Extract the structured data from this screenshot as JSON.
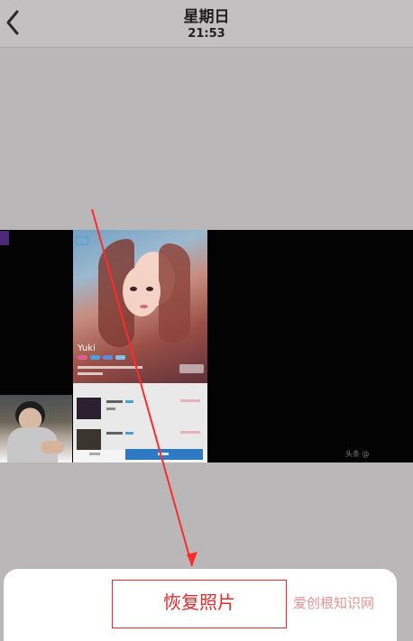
{
  "header": {
    "title": "星期日",
    "subtitle": "21:53",
    "back_icon": "chevron-left-icon"
  },
  "content": {
    "preview_streamer": "Yuki",
    "small_watermark": "头条 @"
  },
  "bottom_sheet": {
    "restore_label": "恢复照片",
    "brand_watermark": "爱创根知识网"
  },
  "colors": {
    "restore": "#e02b2b",
    "arrow": "#ff2b2b"
  }
}
